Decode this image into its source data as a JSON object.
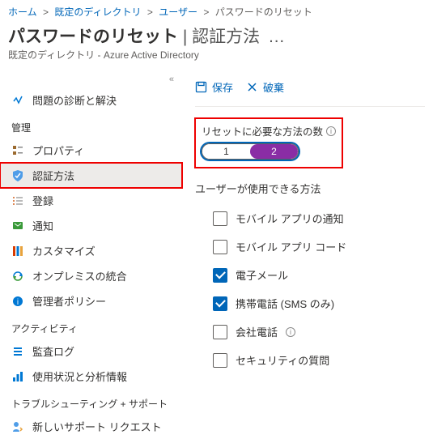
{
  "breadcrumb": {
    "items": [
      "ホーム",
      "既定のディレクトリ",
      "ユーザー",
      "パスワードのリセット"
    ]
  },
  "header": {
    "title_main": "パスワードのリセット",
    "title_divider": " | ",
    "title_sub": "認証方法",
    "subtitle": "既定のディレクトリ - Azure Active Directory"
  },
  "cmdbar": {
    "save": "保存",
    "discard": "破棄"
  },
  "sidebar": {
    "diagnose": "問題の診断と解決",
    "section_manage": "管理",
    "items_manage": [
      "プロパティ",
      "認証方法",
      "登録",
      "通知",
      "カスタマイズ",
      "オンプレミスの統合",
      "管理者ポリシー"
    ],
    "section_activity": "アクティビティ",
    "items_activity": [
      "監査ログ",
      "使用状況と分析情報"
    ],
    "section_support": "トラブルシューティング + サポート",
    "items_support": [
      "新しいサポート リクエスト"
    ]
  },
  "content": {
    "required_label": "リセットに必要な方法の数",
    "opt1": "1",
    "opt2": "2",
    "methods_label": "ユーザーが使用できる方法",
    "methods": [
      {
        "label": "モバイル アプリの通知",
        "checked": false,
        "info": false
      },
      {
        "label": "モバイル アプリ コード",
        "checked": false,
        "info": false
      },
      {
        "label": "電子メール",
        "checked": true,
        "info": false
      },
      {
        "label": "携帯電話 (SMS のみ)",
        "checked": true,
        "info": false
      },
      {
        "label": "会社電話",
        "checked": false,
        "info": true
      },
      {
        "label": "セキュリティの質問",
        "checked": false,
        "info": false
      }
    ]
  }
}
